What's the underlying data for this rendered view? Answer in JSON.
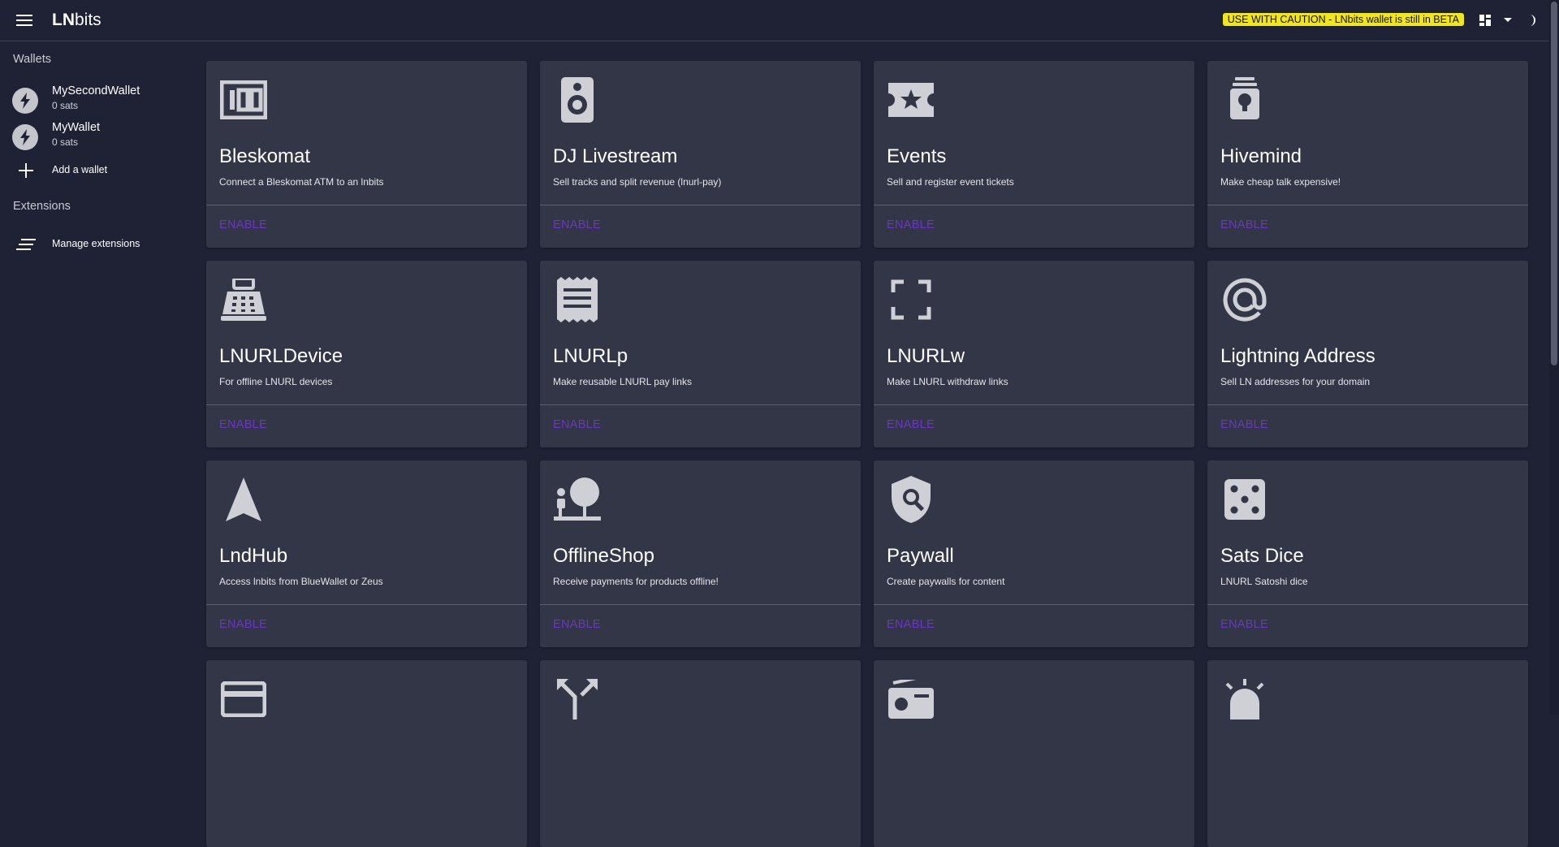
{
  "header": {
    "brand_strong": "LN",
    "brand_rest": "bits",
    "beta_notice": "USE WITH CAUTION - LNbits wallet is still in BETA"
  },
  "sidebar": {
    "wallets_title": "Wallets",
    "wallets": [
      {
        "name": "MySecondWallet",
        "balance": "0 sats"
      },
      {
        "name": "MyWallet",
        "balance": "0 sats"
      }
    ],
    "add_wallet_label": "Add a wallet",
    "extensions_title": "Extensions",
    "manage_extensions_label": "Manage extensions"
  },
  "extensions": [
    {
      "title": "Bleskomat",
      "desc": "Connect a Bleskomat ATM to an lnbits",
      "icon": "money-icon",
      "action": "ENABLE"
    },
    {
      "title": "DJ Livestream",
      "desc": "Sell tracks and split revenue (lnurl-pay)",
      "icon": "speaker-icon",
      "action": "ENABLE"
    },
    {
      "title": "Events",
      "desc": "Sell and register event tickets",
      "icon": "ticket-icon",
      "action": "ENABLE"
    },
    {
      "title": "Hivemind",
      "desc": "Make cheap talk expensive!",
      "icon": "lightbulb-icon",
      "action": "ENABLE"
    },
    {
      "title": "LNURLDevice",
      "desc": "For offline LNURL devices",
      "icon": "point-of-sale-icon",
      "action": "ENABLE"
    },
    {
      "title": "LNURLp",
      "desc": "Make reusable LNURL pay links",
      "icon": "receipt-icon",
      "action": "ENABLE"
    },
    {
      "title": "LNURLw",
      "desc": "Make LNURL withdraw links",
      "icon": "crop-free-icon",
      "action": "ENABLE"
    },
    {
      "title": "Lightning Address",
      "desc": "Sell LN addresses for your domain",
      "icon": "alternate-email-icon",
      "action": "ENABLE"
    },
    {
      "title": "LndHub",
      "desc": "Access lnbits from BlueWallet or Zeus",
      "icon": "navigation-icon",
      "action": "ENABLE"
    },
    {
      "title": "OfflineShop",
      "desc": "Receive payments for products offline!",
      "icon": "nature-people-icon",
      "action": "ENABLE"
    },
    {
      "title": "Paywall",
      "desc": "Create paywalls for content",
      "icon": "policy-icon",
      "action": "ENABLE"
    },
    {
      "title": "Sats Dice",
      "desc": "LNURL Satoshi dice",
      "icon": "casino-icon",
      "action": "ENABLE"
    },
    {
      "title": "",
      "desc": "",
      "icon": "credit-card-icon",
      "action": ""
    },
    {
      "title": "",
      "desc": "",
      "icon": "call-split-icon",
      "action": ""
    },
    {
      "title": "",
      "desc": "",
      "icon": "radio-icon",
      "action": ""
    },
    {
      "title": "",
      "desc": "",
      "icon": "alarm-bell-icon",
      "action": ""
    }
  ]
}
